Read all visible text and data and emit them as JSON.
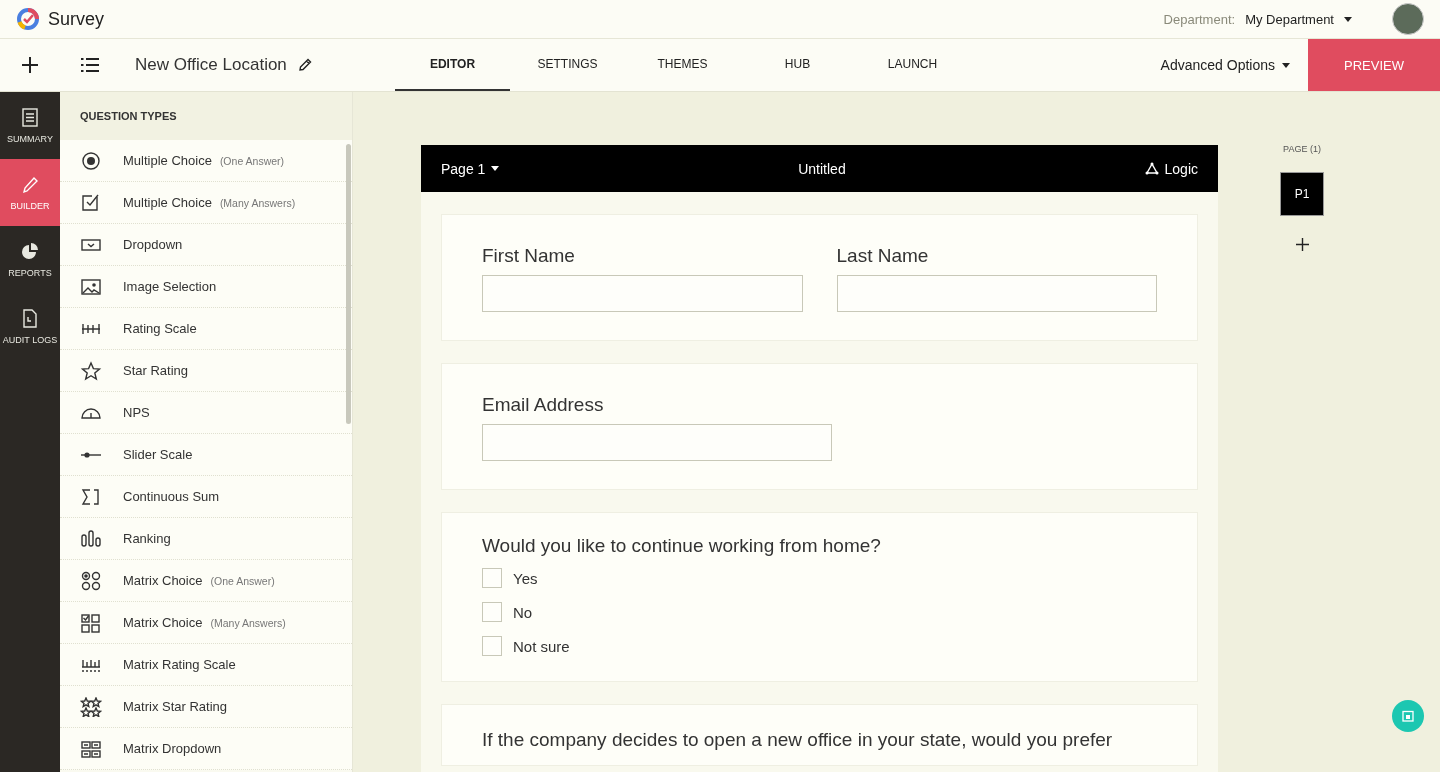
{
  "app": {
    "name": "Survey",
    "department_label": "Department:",
    "department": "My Department"
  },
  "toolbar": {
    "survey_title": "New Office Location",
    "advanced_options": "Advanced Options",
    "preview": "PREVIEW"
  },
  "tabs": [
    {
      "label": "EDITOR",
      "selected": true
    },
    {
      "label": "SETTINGS",
      "selected": false
    },
    {
      "label": "THEMES",
      "selected": false
    },
    {
      "label": "HUB",
      "selected": false
    },
    {
      "label": "LAUNCH",
      "selected": false
    }
  ],
  "rail": [
    {
      "label": "SUMMARY",
      "kind": "summary",
      "selected": false
    },
    {
      "label": "BUILDER",
      "kind": "builder",
      "selected": true
    },
    {
      "label": "REPORTS",
      "kind": "reports",
      "selected": false
    },
    {
      "label": "AUDIT LOGS",
      "kind": "audit",
      "selected": false
    }
  ],
  "question_types": {
    "title": "QUESTION TYPES",
    "items": [
      {
        "label": "Multiple Choice",
        "note": "(One Answer)",
        "kind": "radio"
      },
      {
        "label": "Multiple Choice",
        "note": "(Many Answers)",
        "kind": "checkbox"
      },
      {
        "label": "Dropdown",
        "kind": "dropdown"
      },
      {
        "label": "Image Selection",
        "kind": "image"
      },
      {
        "label": "Rating Scale",
        "kind": "rating"
      },
      {
        "label": "Star Rating",
        "kind": "star"
      },
      {
        "label": "NPS",
        "kind": "nps"
      },
      {
        "label": "Slider Scale",
        "kind": "slider"
      },
      {
        "label": "Continuous Sum",
        "kind": "sum"
      },
      {
        "label": "Ranking",
        "kind": "ranking"
      },
      {
        "label": "Matrix Choice",
        "note": "(One Answer)",
        "kind": "matrix-radio"
      },
      {
        "label": "Matrix Choice",
        "note": "(Many Answers)",
        "kind": "matrix-checkbox"
      },
      {
        "label": "Matrix Rating Scale",
        "kind": "matrix-rating"
      },
      {
        "label": "Matrix Star Rating",
        "kind": "matrix-star"
      },
      {
        "label": "Matrix Dropdown",
        "kind": "matrix-dropdown"
      }
    ]
  },
  "form": {
    "page": "Page 1",
    "title": "Untitled",
    "logic": "Logic",
    "questions": [
      {
        "kind": "name-pair",
        "fields": [
          {
            "label": "First Name"
          },
          {
            "label": "Last Name"
          }
        ]
      },
      {
        "kind": "text",
        "label": "Email Address"
      },
      {
        "kind": "choices",
        "label": "Would you like to continue working from home?",
        "options": [
          {
            "label": "Yes",
            "checked": false
          },
          {
            "label": "No",
            "checked": false
          },
          {
            "label": "Not sure",
            "checked": false
          }
        ]
      },
      {
        "kind": "partial",
        "label": "If the company decides to open a new office in your state, would you prefer"
      }
    ]
  },
  "pages": {
    "title": "PAGE (1)",
    "items": [
      {
        "label": "P1",
        "selected": true
      }
    ]
  }
}
